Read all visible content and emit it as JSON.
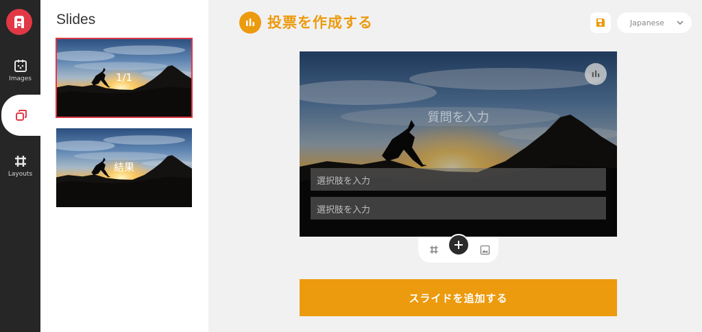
{
  "rail": {
    "items": [
      {
        "label": "Images",
        "icon": "images-icon"
      },
      {
        "label": "",
        "icon": "slides-icon"
      },
      {
        "label": "Layouts",
        "icon": "layouts-icon"
      }
    ]
  },
  "slides_panel": {
    "title": "Slides",
    "slides": [
      {
        "caption": "1/1",
        "selected": true
      },
      {
        "caption": "結果",
        "selected": false
      }
    ]
  },
  "header": {
    "title": "投票を作成する",
    "language": "Japanese"
  },
  "canvas": {
    "question_placeholder": "質問を入力",
    "choices": [
      {
        "placeholder": "選択肢を入力"
      },
      {
        "placeholder": "選択肢を入力"
      }
    ]
  },
  "footer": {
    "add_slide_label": "スライドを追加する"
  },
  "colors": {
    "accent": "#ec9a0e",
    "brand": "#e23846",
    "rail": "#262626"
  }
}
